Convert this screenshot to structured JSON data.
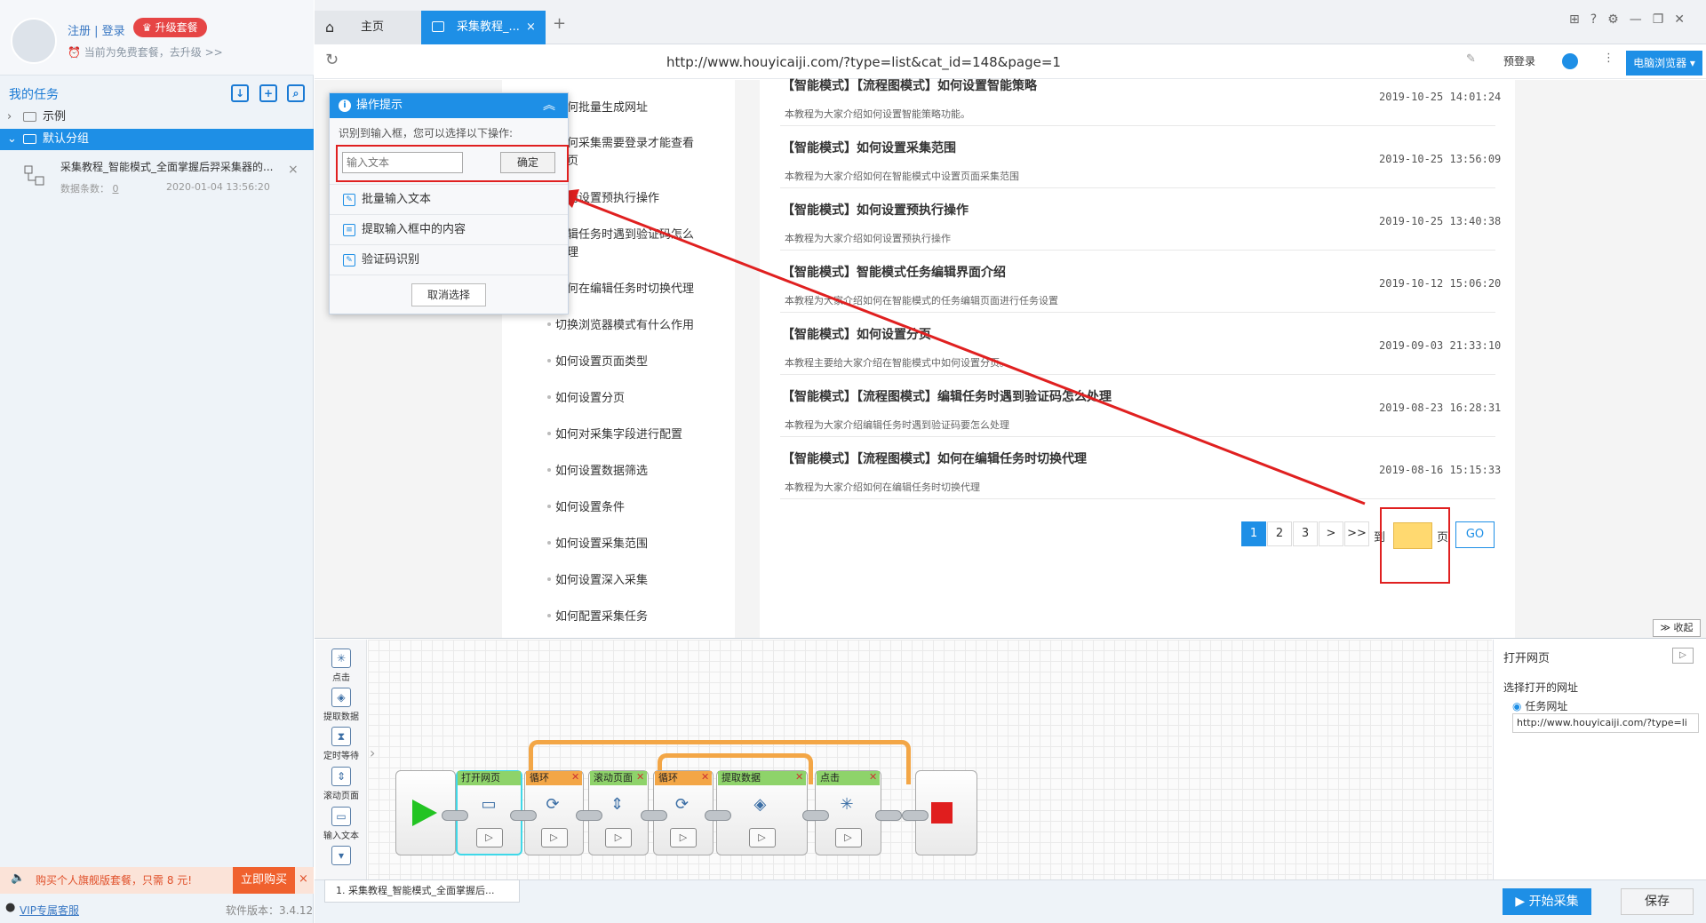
{
  "user": {
    "login": "注册 | 登录",
    "upgrade": "升级套餐",
    "free_notice": "当前为免费套餐，去升级 >>"
  },
  "tasks": {
    "header": "我的任务",
    "tree": [
      {
        "label": "示例"
      },
      {
        "label": "默认分组"
      }
    ],
    "item": {
      "name": "采集教程_智能模式_全面掌握后羿采集器的...",
      "count_label": "数据条数：",
      "count": "0",
      "date": "2020-01-04 13:56:20"
    }
  },
  "promo": {
    "text": "购买个人旗舰版套餐，只需 8 元!",
    "buy": "立即购买"
  },
  "footer": {
    "vip": "VIP专属客服",
    "version": "软件版本：3.4.12"
  },
  "browser": {
    "tabs": [
      {
        "label": "主页"
      },
      {
        "label": "采集教程_..."
      }
    ],
    "url": "http://www.houyicaiji.com/?type=list&cat_id=148&page=1",
    "prelogin": "预登录",
    "browser_btn": "电脑浏览器"
  },
  "categories": [
    "如何批量生成网址",
    "如何采集需要登录才能查看",
    "网页",
    "如何设置预执行操作",
    "编辑任务时遇到验证码怎么",
    "处理",
    "如何在编辑任务时切换代理",
    "切换浏览器模式有什么作用",
    "如何设置页面类型",
    "如何设置分页",
    "如何对采集字段进行配置",
    "如何设置数据筛选",
    "如何设置条件",
    "如何设置采集范围",
    "如何设置深入采集",
    "如何配置采集任务"
  ],
  "articles": [
    {
      "title": "【智能模式】【流程图模式】如何设置智能策略",
      "desc": "本教程为大家介绍如何设置智能策略功能。",
      "date": "2019-10-25 14:01:24"
    },
    {
      "title": "【智能模式】如何设置采集范围",
      "desc": "本教程为大家介绍如何在智能模式中设置页面采集范围",
      "date": "2019-10-25 13:56:09"
    },
    {
      "title": "【智能模式】如何设置预执行操作",
      "desc": "本教程为大家介绍如何设置预执行操作",
      "date": "2019-10-25 13:40:38"
    },
    {
      "title": "【智能模式】智能模式任务编辑界面介绍",
      "desc": "本教程为大家介绍如何在智能模式的任务编辑页面进行任务设置",
      "date": "2019-10-12 15:06:20"
    },
    {
      "title": "【智能模式】如何设置分页",
      "desc": "本教程主要给大家介绍在智能模式中如何设置分页。",
      "date": "2019-09-03 21:33:10"
    },
    {
      "title": "【智能模式】【流程图模式】编辑任务时遇到验证码怎么处理",
      "desc": "本教程为大家介绍编辑任务时遇到验证码要怎么处理",
      "date": "2019-08-23 16:28:31"
    },
    {
      "title": "【智能模式】【流程图模式】如何在编辑任务时切换代理",
      "desc": "本教程为大家介绍如何在编辑任务时切换代理",
      "date": "2019-08-16 15:15:33"
    }
  ],
  "pagination": {
    "pages": [
      "1",
      "2",
      "3",
      ">",
      ">>"
    ],
    "to": "到",
    "page": "页",
    "go": "GO"
  },
  "popup": {
    "title": "操作提示",
    "hint": "识别到输入框，您可以选择以下操作:",
    "placeholder": "输入文本",
    "confirm": "确定",
    "items": [
      "批量输入文本",
      "提取输入框中的内容",
      "验证码识别"
    ],
    "cancel": "取消选择"
  },
  "collapse": "收起",
  "palette": [
    "点击",
    "提取数据",
    "定时等待",
    "滚动页面",
    "输入文本"
  ],
  "flow": {
    "nodes": [
      "打开网页",
      "循环",
      "滚动页面",
      "循环",
      "提取数据",
      "点击"
    ]
  },
  "panel": {
    "title": "打开网页",
    "subtitle": "选择打开的网址",
    "radio": "任务网址",
    "url": "http://www.houyicaiji.com/?type=li"
  },
  "bottom": {
    "tab": "1. 采集教程_智能模式_全面掌握后...",
    "start": "开始采集",
    "save": "保存"
  },
  "colors": {
    "accent": "#1e8fe6",
    "highlight": "#e02020",
    "input_bg": "#ffd970"
  }
}
